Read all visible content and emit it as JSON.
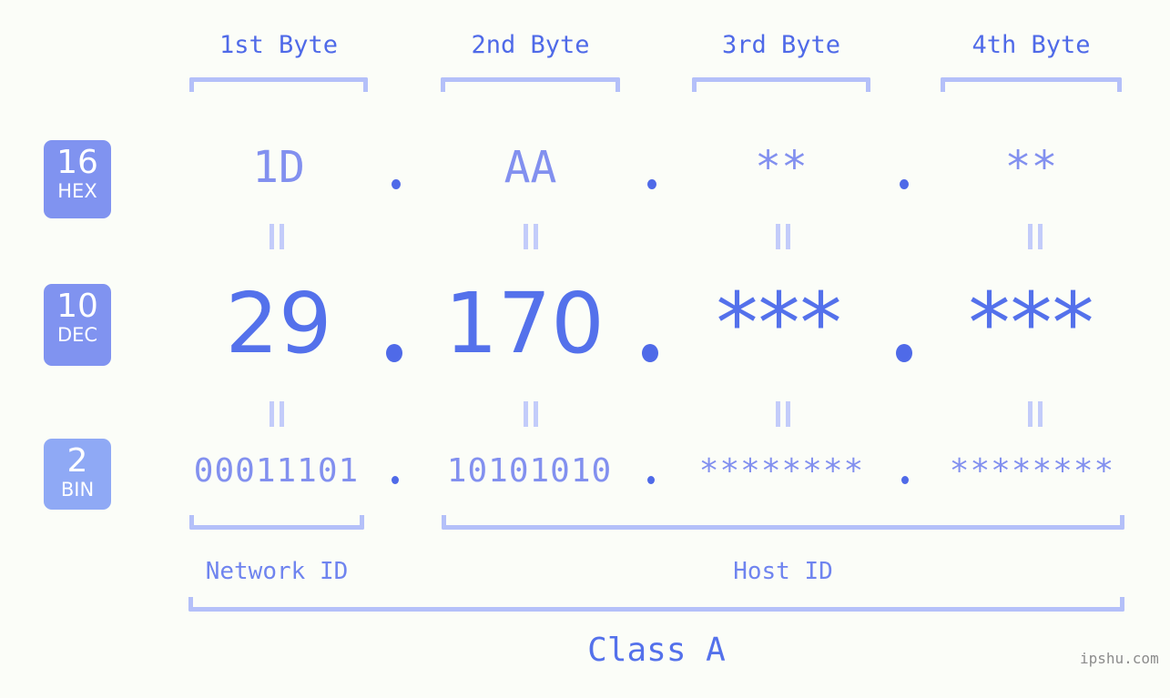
{
  "meta": {
    "background_color": "#fbfdf8",
    "accent_color": "#5471eb",
    "accent_light_color": "#8290ef",
    "bracket_color": "#b4c0f9",
    "badge_color": "#8093f0",
    "badge_bin_color": "#8fa9f5",
    "watermark": "ipshu.com"
  },
  "byte_headers": [
    {
      "label": "1st Byte"
    },
    {
      "label": "2nd Byte"
    },
    {
      "label": "3rd Byte"
    },
    {
      "label": "4th Byte"
    }
  ],
  "rows": [
    {
      "badge": {
        "number": "16",
        "abbr": "HEX"
      },
      "values": [
        "1D",
        "AA",
        "**",
        "**"
      ],
      "separator": "."
    },
    {
      "badge": {
        "number": "10",
        "abbr": "DEC"
      },
      "values": [
        "29",
        "170",
        "***",
        "***"
      ],
      "separator": "."
    },
    {
      "badge": {
        "number": "2",
        "abbr": "BIN"
      },
      "values": [
        "00011101",
        "10101010",
        "********",
        "********"
      ],
      "separator": "."
    }
  ],
  "equality_marks": {
    "glyph": "‖",
    "count_per_row_gap": 4
  },
  "id_sections": [
    {
      "label": "Network ID"
    },
    {
      "label": "Host ID"
    }
  ],
  "class": {
    "label": "Class A"
  }
}
